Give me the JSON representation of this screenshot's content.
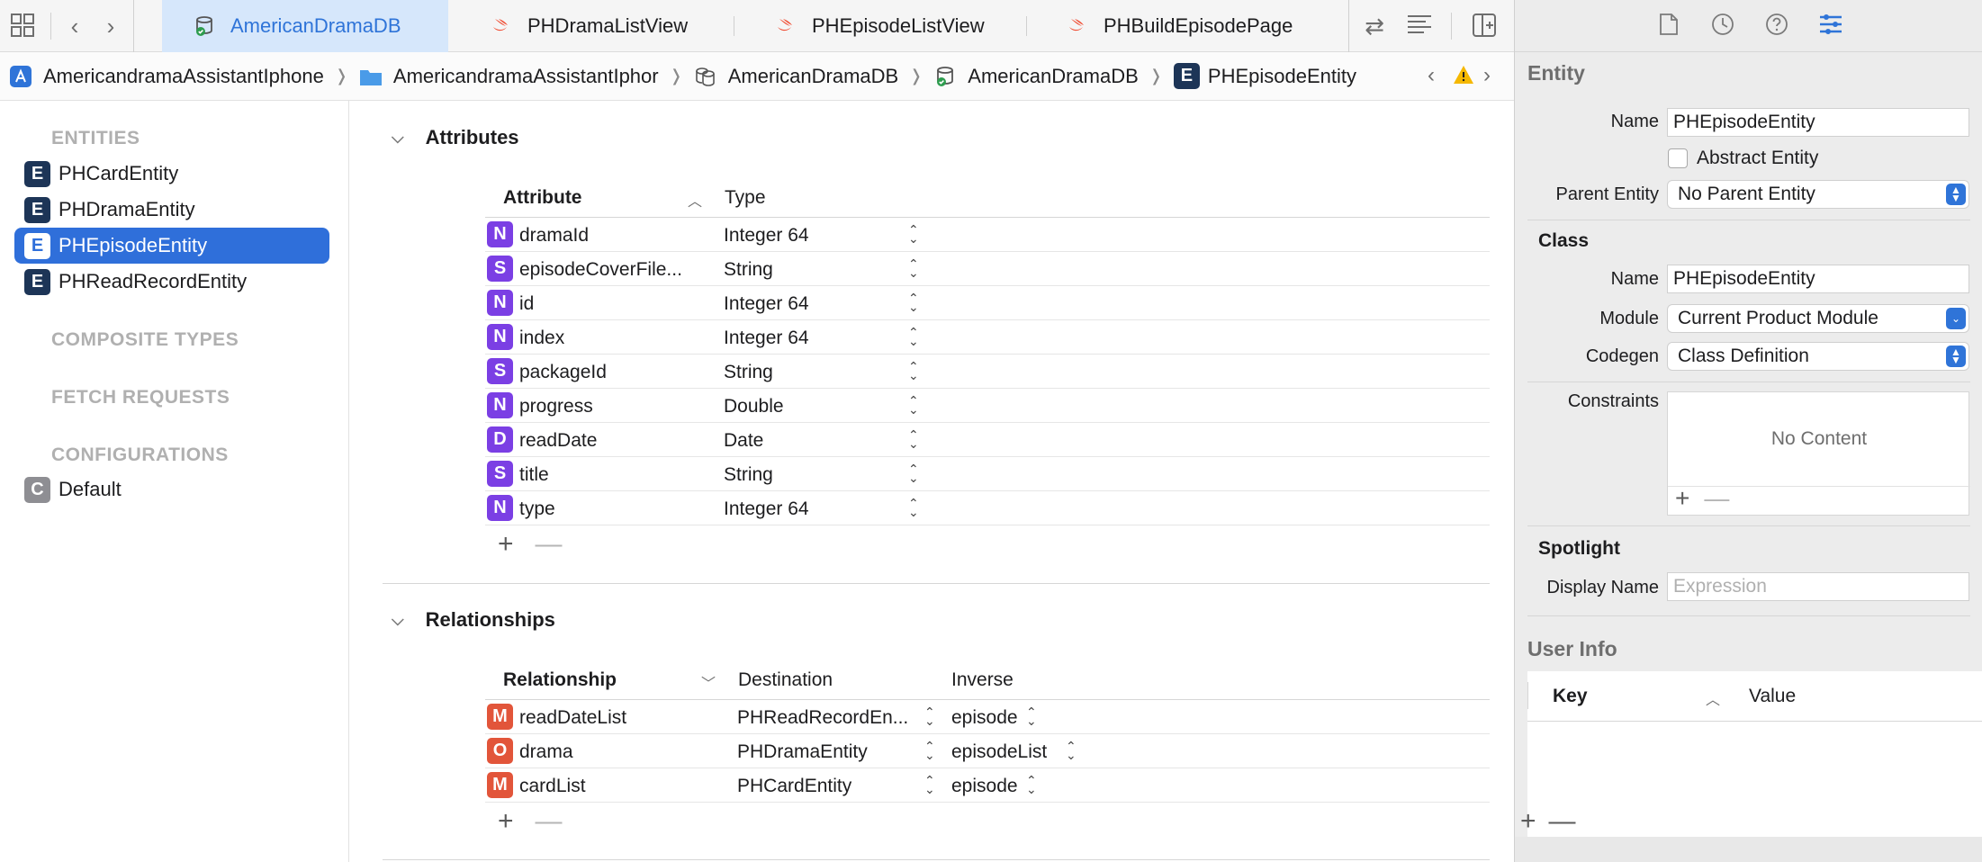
{
  "tabs": [
    {
      "label": "AmericanDramaDB",
      "icon": "database-icon",
      "active": true
    },
    {
      "label": "PHDramaListView",
      "icon": "swift-icon",
      "active": false
    },
    {
      "label": "PHEpisodeListView",
      "icon": "swift-icon",
      "active": false
    },
    {
      "label": "PHBuildEpisodePage",
      "icon": "swift-icon",
      "active": false
    }
  ],
  "breadcrumb": [
    {
      "label": "AmericandramaAssistantIphone",
      "icon": "app-icon"
    },
    {
      "label": "AmericandramaAssistantIphor",
      "icon": "folder-icon"
    },
    {
      "label": "AmericanDramaDB",
      "icon": "model-versions-icon"
    },
    {
      "label": "AmericanDramaDB",
      "icon": "database-icon"
    },
    {
      "label": "PHEpisodeEntity",
      "icon": "entity-icon",
      "badge": "E"
    }
  ],
  "sidebar": {
    "entities_header": "ENTITIES",
    "entities": [
      {
        "label": "PHCardEntity",
        "badge": "E"
      },
      {
        "label": "PHDramaEntity",
        "badge": "E"
      },
      {
        "label": "PHEpisodeEntity",
        "badge": "E",
        "selected": true
      },
      {
        "label": "PHReadRecordEntity",
        "badge": "E"
      }
    ],
    "composite_header": "COMPOSITE TYPES",
    "fetch_header": "FETCH REQUESTS",
    "config_header": "CONFIGURATIONS",
    "configurations": [
      {
        "label": "Default",
        "badge": "C"
      }
    ]
  },
  "attributes": {
    "title": "Attributes",
    "col_attribute": "Attribute",
    "col_type": "Type",
    "rows": [
      {
        "badge": "N",
        "name": "dramaId",
        "type": "Integer 64"
      },
      {
        "badge": "S",
        "name": "episodeCoverFile...",
        "type": "String"
      },
      {
        "badge": "N",
        "name": "id",
        "type": "Integer 64"
      },
      {
        "badge": "N",
        "name": "index",
        "type": "Integer 64"
      },
      {
        "badge": "S",
        "name": "packageId",
        "type": "String"
      },
      {
        "badge": "N",
        "name": "progress",
        "type": "Double"
      },
      {
        "badge": "D",
        "name": "readDate",
        "type": "Date"
      },
      {
        "badge": "S",
        "name": "title",
        "type": "String"
      },
      {
        "badge": "N",
        "name": "type",
        "type": "Integer 64"
      }
    ]
  },
  "relationships": {
    "title": "Relationships",
    "col_relationship": "Relationship",
    "col_destination": "Destination",
    "col_inverse": "Inverse",
    "rows": [
      {
        "badge": "M",
        "name": "readDateList",
        "destination": "PHReadRecordEn...",
        "inverse": "episode"
      },
      {
        "badge": "O",
        "name": "drama",
        "destination": "PHDramaEntity",
        "inverse": "episodeList"
      },
      {
        "badge": "M",
        "name": "cardList",
        "destination": "PHCardEntity",
        "inverse": "episode"
      }
    ]
  },
  "controls": {
    "add": "+",
    "remove": "—"
  },
  "inspector": {
    "entity_title": "Entity",
    "name_label": "Name",
    "name_value": "PHEpisodeEntity",
    "abstract_label": "Abstract Entity",
    "parent_label": "Parent Entity",
    "parent_value": "No Parent Entity",
    "class_title": "Class",
    "class_name_label": "Name",
    "class_name_value": "PHEpisodeEntity",
    "module_label": "Module",
    "module_value": "Current Product Module",
    "codegen_label": "Codegen",
    "codegen_value": "Class Definition",
    "constraints_label": "Constraints",
    "constraints_empty": "No Content",
    "spotlight_title": "Spotlight",
    "display_name_label": "Display Name",
    "display_name_placeholder": "Expression",
    "userinfo_title": "User Info",
    "col_key": "Key",
    "col_value": "Value"
  },
  "colors": {
    "accent": "#2f74d8",
    "selection": "#2f6fda",
    "entity_badge": "#1d3557",
    "attr_badge": "#7b3fe4",
    "rel_badge": "#e2553a",
    "config_badge": "#8e8e93"
  }
}
